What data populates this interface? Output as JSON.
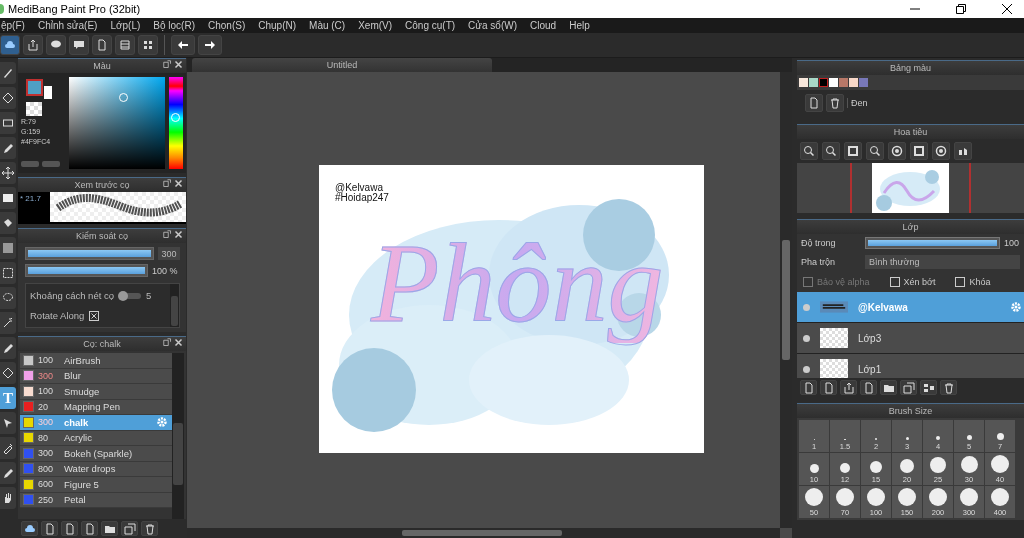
{
  "window": {
    "title": "MediBang Paint Pro (32bit)"
  },
  "menu": [
    "ệp(F)",
    "Chỉnh sửa(E)",
    "Lớp(L)",
    "Bộ lọc(R)",
    "Chọn(S)",
    "Chụp(N)",
    "Màu (C)",
    "Xem(V)",
    "Công cụ(T)",
    "Cửa sổ(W)",
    "Cloud",
    "Help"
  ],
  "tools": [
    {
      "kind": "brush",
      "selected": false
    },
    {
      "kind": "eraser",
      "selected": false
    },
    {
      "kind": "rectangle",
      "selected": false
    },
    {
      "kind": "pen",
      "selected": false
    },
    {
      "kind": "move",
      "selected": false
    },
    {
      "kind": "fill",
      "selected": false
    },
    {
      "kind": "bucket",
      "selected": false
    },
    {
      "kind": "gradient",
      "selected": false
    },
    {
      "kind": "select",
      "selected": false
    },
    {
      "kind": "lasso",
      "selected": false
    },
    {
      "kind": "wand",
      "selected": false
    },
    {
      "kind": "pen",
      "selected": false
    },
    {
      "kind": "eraser",
      "selected": false
    },
    {
      "kind": "text",
      "label": "T",
      "selected": true
    },
    {
      "kind": "arrow",
      "selected": false
    },
    {
      "kind": "dropper",
      "selected": false
    },
    {
      "kind": "pen",
      "selected": false
    },
    {
      "kind": "hand",
      "selected": false
    }
  ],
  "color_panel": {
    "title": "Màu",
    "r": "R:79",
    "g": "G:159",
    "hex": "#4F9FC4"
  },
  "brush_preview": {
    "title": "Xem trước cọ",
    "size": "* 21.7"
  },
  "brush_control": {
    "title": "Kiểm soát cọ",
    "size": {
      "level": 1,
      "value": "300"
    },
    "opacity": {
      "level": 1,
      "value": "100 %"
    },
    "spacing": {
      "label": "Khoảng cách nét cọ",
      "level": 0.2,
      "value": "5"
    },
    "rotate": {
      "label": "Rotate Along",
      "checked": true
    }
  },
  "brush_list": {
    "title": "Cọ: chalk",
    "items": [
      {
        "color": "#c8c8c8",
        "size": "100",
        "name": "AirBrush",
        "size_warning": false,
        "selected": false
      },
      {
        "color": "#f0a0e8",
        "size": "300",
        "name": "Blur",
        "size_warning": true,
        "selected": false
      },
      {
        "color": "#f8dcd0",
        "size": "100",
        "name": "Smudge",
        "size_warning": false,
        "selected": false
      },
      {
        "color": "#e82020",
        "size": "20",
        "name": "Mapping Pen",
        "size_warning": false,
        "selected": false
      },
      {
        "color": "#e8d800",
        "size": "300",
        "name": "chalk",
        "size_warning": true,
        "selected": true
      },
      {
        "color": "#e8d800",
        "size": "80",
        "name": "Acrylic",
        "size_warning": false,
        "selected": false
      },
      {
        "color": "#3050f0",
        "size": "300",
        "name": "Bokeh (Sparkle)",
        "size_warning": false,
        "selected": false
      },
      {
        "color": "#3050f0",
        "size": "800",
        "name": "Water drops",
        "size_warning": false,
        "selected": false
      },
      {
        "color": "#e8d800",
        "size": "600",
        "name": "Figure 5",
        "size_warning": false,
        "selected": false
      },
      {
        "color": "#3050f0",
        "size": "250",
        "name": "Petal",
        "size_warning": false,
        "selected": false
      }
    ]
  },
  "canvas": {
    "tab": "Untitled",
    "credit": "@Kelvawa",
    "tag": "#Hoidap247",
    "lettering": "Phông"
  },
  "palette": {
    "title": "Bảng màu",
    "swatches": [
      {
        "color": "#f8e8dc",
        "selected": false
      },
      {
        "color": "#a8d8c8",
        "selected": false
      },
      {
        "color": "#000000",
        "selected": true
      },
      {
        "color": "#ffffff",
        "selected": false
      },
      {
        "color": "#b87868",
        "selected": false
      },
      {
        "color": "#f8d8c8",
        "selected": false
      },
      {
        "color": "#7878b8",
        "selected": false
      }
    ],
    "color_name": "Đen"
  },
  "navigator": {
    "title": "Hoa tiêu"
  },
  "layers": {
    "title": "Lớp",
    "opacity": {
      "label": "Độ trong",
      "level": 1,
      "value": "100"
    },
    "blend": {
      "label": "Pha trộn",
      "value": "Bình thường"
    },
    "options": [
      {
        "label": "Bảo vệ alpha",
        "checked": false,
        "disabled": true
      },
      {
        "label": "Xén bớt",
        "checked": false,
        "disabled": false
      },
      {
        "label": "Khóa",
        "checked": false,
        "disabled": false
      }
    ],
    "items": [
      {
        "name": "@Kelvawa",
        "kind": "text",
        "selected": true,
        "visible": true
      },
      {
        "name": "Lớp3",
        "kind": "empty",
        "selected": false,
        "visible": true
      },
      {
        "name": "Lớp1",
        "kind": "empty",
        "selected": false,
        "visible": true
      }
    ]
  },
  "brush_size": {
    "title": "Brush Size",
    "sizes": [
      "1",
      "1.5",
      "2",
      "3",
      "4",
      "5",
      "7",
      "10",
      "12",
      "15",
      "20",
      "25",
      "30",
      "40",
      "50",
      "70",
      "100",
      "150",
      "200",
      "300",
      "400"
    ]
  }
}
